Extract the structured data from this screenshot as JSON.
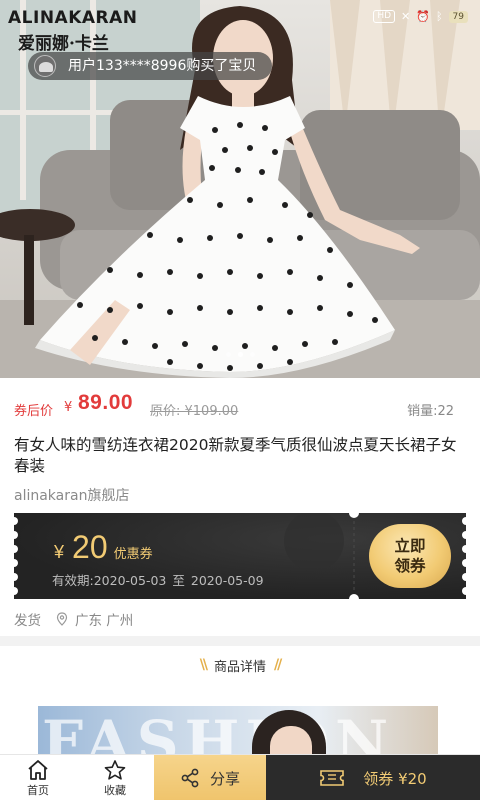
{
  "status_bar": {
    "hd": "HD",
    "battery": "79"
  },
  "hero": {
    "brand_en": "ALINAKARAN",
    "brand_cn": "爱丽娜·卡兰",
    "purchase_toast": "用户133****8996购买了宝贝",
    "carousel_dots": 3,
    "carousel_active": 2
  },
  "product": {
    "coupon_price_label": "券后价",
    "currency": "¥",
    "price": "89.00",
    "original_price": "原价: ¥109.00",
    "sales": "销量:22",
    "title": "有女人味的雪纺连衣裙2020新款夏季气质很仙波点夏天长裙子女春装",
    "shop": "alinakaran旗舰店"
  },
  "coupon": {
    "yen": "¥",
    "amount": "20",
    "tag": "优惠券",
    "valid_label": "有效期:",
    "valid_from": "2020-05-03",
    "valid_to_label": "至",
    "valid_to": "2020-05-09",
    "button_line1": "立即",
    "button_line2": "领券"
  },
  "shipping": {
    "label": "发货",
    "location": "广东 广州"
  },
  "details": {
    "heading": "商品详情",
    "banner_word": "FASHION"
  },
  "bottom_nav": {
    "home": "首页",
    "favorite": "收藏",
    "share": "分享",
    "claim": "领券 ¥20"
  },
  "colors": {
    "price_red": "#e23b3b",
    "gold": "#f2cb74",
    "coupon_dark": "#2b2b2b"
  }
}
